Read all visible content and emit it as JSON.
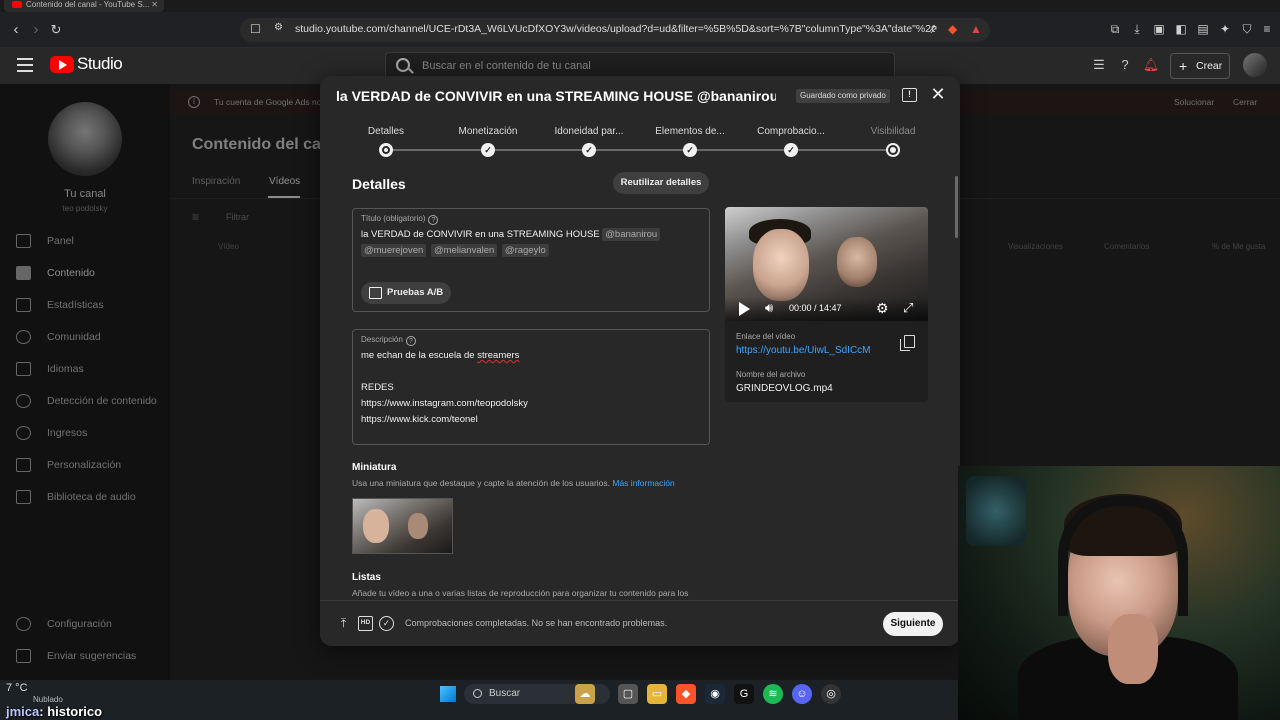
{
  "browser": {
    "tab_title": "Contenido del canal - YouTube S...",
    "url": "studio.youtube.com/channel/UCE-rDt3A_W6LVUcDfXOY3w/videos/upload?d=ud&filter=%5B%5D&sort=%7B\"columnType\"%3A\"date\"%2C\"sortOrder..."
  },
  "studio_header": {
    "logo_text": "Studio",
    "search_placeholder": "Buscar en el contenido de tu canal",
    "create_label": "Crear"
  },
  "sidebar": {
    "channel_title": "Tu canal",
    "channel_handle": "teo podolsky",
    "items": [
      {
        "label": "Panel",
        "icon": "dashboard-icon"
      },
      {
        "label": "Contenido",
        "icon": "content-icon",
        "active": true
      },
      {
        "label": "Estadísticas",
        "icon": "analytics-icon"
      },
      {
        "label": "Comunidad",
        "icon": "community-icon"
      },
      {
        "label": "Idiomas",
        "icon": "subtitles-icon"
      },
      {
        "label": "Detección de contenido",
        "icon": "copyright-icon"
      },
      {
        "label": "Ingresos",
        "icon": "monetization-icon"
      },
      {
        "label": "Personalización",
        "icon": "customization-icon"
      },
      {
        "label": "Biblioteca de audio",
        "icon": "audio-library-icon"
      }
    ],
    "bottom_items": [
      {
        "label": "Configuración",
        "icon": "settings-icon"
      },
      {
        "label": "Enviar sugerencias",
        "icon": "feedback-icon"
      }
    ]
  },
  "background_page": {
    "ads_banner": "Tu cuenta de Google Ads no",
    "ads_fix": "Solucionar",
    "ads_close": "Cerrar",
    "title": "Contenido del canal",
    "tabs": [
      "Inspiración",
      "Vídeos"
    ],
    "filter_placeholder": "Filtrar",
    "columns": [
      "Vídeo",
      "Visualizaciones",
      "Comentarios",
      "% de Me gusta"
    ]
  },
  "dialog": {
    "title": "la VERDAD de CONVIVIR en una STREAMING HOUSE @bananirou @muer...",
    "saved_chip": "Guardado como privado",
    "steps": [
      {
        "label": "Detalles",
        "state": "current"
      },
      {
        "label": "Monetización",
        "state": "done"
      },
      {
        "label": "Idoneidad par...",
        "state": "done"
      },
      {
        "label": "Elementos de...",
        "state": "done"
      },
      {
        "label": "Comprobacio...",
        "state": "done"
      },
      {
        "label": "Visibilidad",
        "state": "empty"
      }
    ],
    "section_title": "Detalles",
    "reuse_label": "Reutilizar detalles",
    "title_field": {
      "label": "Título (obligatorio)",
      "text": "la VERDAD de CONVIVIR en una STREAMING HOUSE",
      "mentions": [
        "@bananirou",
        "@muerejoven",
        "@melianvalen",
        "@rageylo"
      ]
    },
    "ab_test_label": "Pruebas A/B",
    "description": {
      "label": "Descripción",
      "line1_prefix": "me echan de la escuela de ",
      "line1_word": "streamers",
      "line2": "REDES",
      "line3": "https://www.instagram.com/teopodolsky",
      "line4": "https://www.kick.com/teonel"
    },
    "video": {
      "time": "00:00 / 14:47",
      "link_label": "Enlace del vídeo",
      "link": "https://youtu.be/UiwL_SdICcM",
      "file_label": "Nombre del archivo",
      "file_name": "GRINDEOVLOG.mp4"
    },
    "thumbnail": {
      "heading": "Miniatura",
      "text": "Usa una miniatura que destaque y capte la atención de los usuarios.",
      "link": "Más información"
    },
    "playlists": {
      "heading": "Listas",
      "text": "Añade tu vídeo a una o varias listas de reproducción para organizar tu contenido para los"
    },
    "footer": {
      "status": "Comprobaciones completadas. No se han encontrado problemas.",
      "next_label": "Siguiente"
    }
  },
  "taskbar": {
    "temp": "7 °C",
    "weather": "Nublado",
    "search_label": "Buscar",
    "chat_nick": "jmica",
    "chat_msg": ": historico"
  }
}
